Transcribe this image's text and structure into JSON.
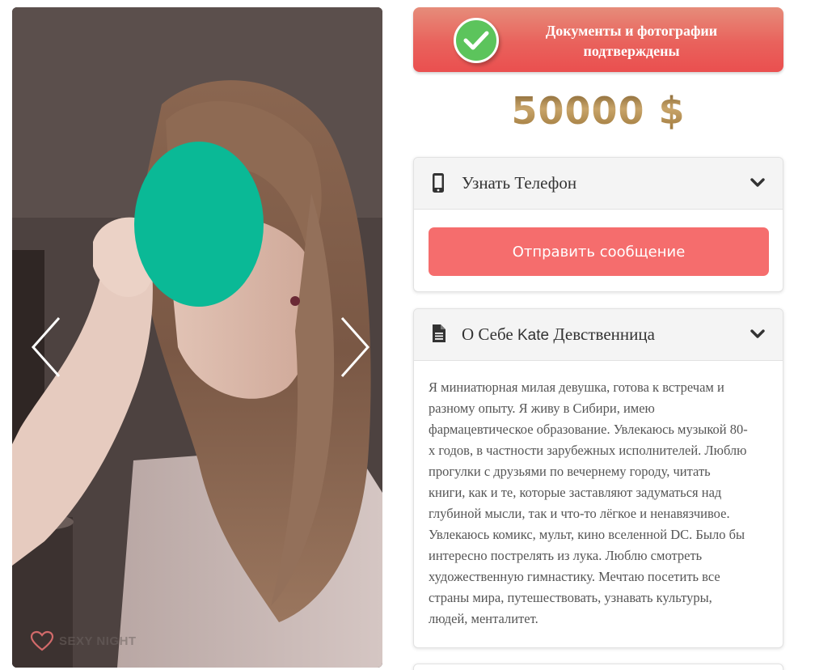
{
  "gallery": {
    "prev_icon": "chevron-left-icon",
    "next_icon": "chevron-right-icon",
    "watermark_icon": "heart-icon",
    "watermark_text": "SEXY NIGHT"
  },
  "verified": {
    "icon": "check-circle-icon",
    "line1": "Документы и фотографии",
    "line2": "подтверждены",
    "accent": "#ea5656"
  },
  "price": {
    "amount": "50000 $",
    "color": "#b08b4c"
  },
  "phone_card": {
    "icon": "phone-icon",
    "title": "Узнать Телефон",
    "toggle_icon": "chevron-down-icon",
    "send_button": "Отправить сообщение",
    "button_color": "#f56d6d"
  },
  "about_card": {
    "icon": "document-icon",
    "title_prefix": "О Себе",
    "name": "Kate",
    "title_suffix": "Девственница",
    "toggle_icon": "chevron-down-icon",
    "lines": [
      "Я миниатюрная милая девушка, готова к встречам и",
      "разному опыту. Я живу в Сибири, имею",
      "фармацевтическое образование. Увлекаюсь музыкой 80-",
      "х годов, в частности зарубежных исполнителей. Люблю",
      "прогулки с друзьями по вечернему городу, читать",
      "книги, как и те, которые заставляют задуматься над",
      "глубиной мысли, так и что-то лёгкое и ненавязчивое.",
      "Увлекаюсь комикс, мульт, кино вселенной DC. Было бы",
      "интересно пострелять из лука. Люблю смотреть",
      "художественную гимнастику. Мечтаю посетить все",
      "страны мира, путешествовать, узнавать культуры,",
      "людей, менталитет."
    ]
  }
}
